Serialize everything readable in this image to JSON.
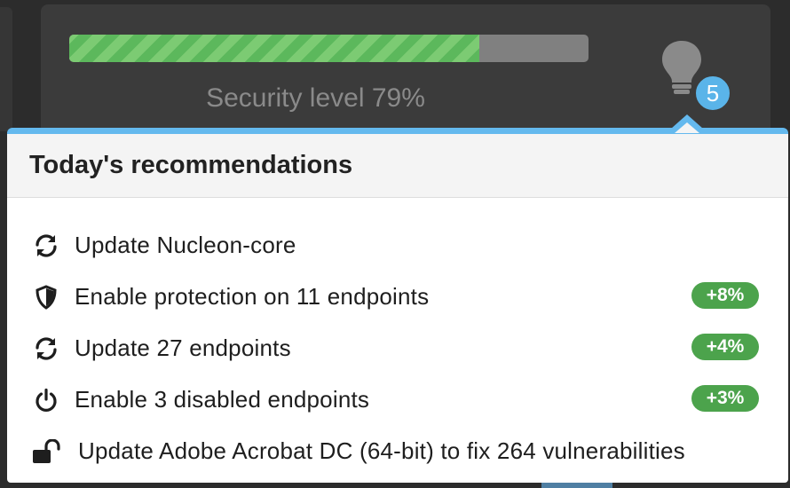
{
  "security": {
    "label": "Security level 79%",
    "level_percent": 79,
    "bar_fill_color": "#5cb85c",
    "bar_stripe_color": "#7ccb73"
  },
  "recommendations_button": {
    "icon": "lightbulb-icon",
    "count": "5",
    "badge_color": "#5ab4e9"
  },
  "popover": {
    "title": "Today's recommendations",
    "accent_color": "#64b9ee",
    "items": [
      {
        "icon": "refresh-icon",
        "label": "Update Nucleon-core",
        "badge": ""
      },
      {
        "icon": "shield-icon",
        "label": "Enable protection on 11 endpoints",
        "badge": "+8%"
      },
      {
        "icon": "refresh-icon",
        "label": "Update 27 endpoints",
        "badge": "+4%"
      },
      {
        "icon": "power-icon",
        "label": "Enable 3 disabled endpoints",
        "badge": "+3%"
      },
      {
        "icon": "unlock-icon",
        "label": "Update Adobe Acrobat DC (64-bit) to fix 264 vulnerabilities",
        "badge": ""
      }
    ],
    "badge_color": "#4ca34c"
  }
}
